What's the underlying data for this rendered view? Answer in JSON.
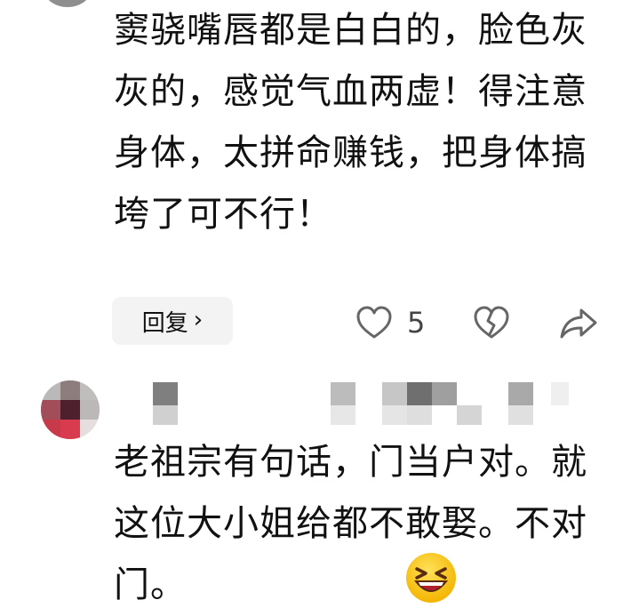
{
  "comments": [
    {
      "text": "窦骁嘴唇都是白白的，脸色灰灰的，感觉气血两虚！得注意身体，太拼命赚钱，把身体搞垮了可不行！",
      "reply_label": "回复",
      "reply_chevron": "›",
      "like_count": "5"
    },
    {
      "text": "老祖宗有句话，门当户对。就这位大小姐给都不敢娶。不对门。"
    }
  ],
  "icons": {
    "like": "heart-outline-icon",
    "dislike": "broken-heart-icon",
    "share": "share-arrow-icon",
    "emoji": "laughing-emoji"
  },
  "colors": {
    "text": "#111111",
    "reply_bg": "#f3f3f3",
    "icon": "#666666"
  }
}
